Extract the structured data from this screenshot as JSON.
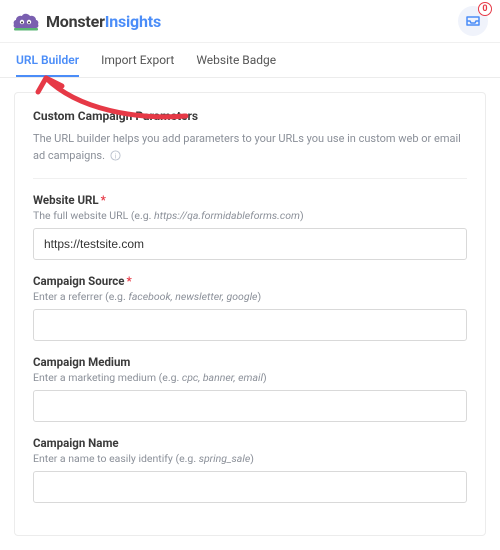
{
  "brand": {
    "dark": "Monster",
    "blue": "Insights"
  },
  "notif": {
    "count": "0"
  },
  "tabs": [
    {
      "label": "URL Builder",
      "active": true
    },
    {
      "label": "Import Export",
      "active": false
    },
    {
      "label": "Website Badge",
      "active": false
    }
  ],
  "panel": {
    "title": "Custom Campaign Parameters",
    "helper": "The URL builder helps you add parameters to your URLs you use in custom web or email ad campaigns."
  },
  "fields": {
    "website_url": {
      "label": "Website URL",
      "required": true,
      "hint_pre": "The full website URL (e.g. ",
      "hint_em": "https://qa.formidableforms.com",
      "hint_post": ")",
      "value": "https://testsite.com"
    },
    "campaign_source": {
      "label": "Campaign Source",
      "required": true,
      "hint_pre": "Enter a referrer (e.g. ",
      "hint_em": "facebook, newsletter, google",
      "hint_post": ")",
      "value": ""
    },
    "campaign_medium": {
      "label": "Campaign Medium",
      "required": false,
      "hint_pre": "Enter a marketing medium (e.g. ",
      "hint_em": "cpc, banner, email",
      "hint_post": ")",
      "value": ""
    },
    "campaign_name": {
      "label": "Campaign Name",
      "required": false,
      "hint_pre": "Enter a name to easily identify (e.g. ",
      "hint_em": "spring_sale",
      "hint_post": ")",
      "value": ""
    }
  }
}
